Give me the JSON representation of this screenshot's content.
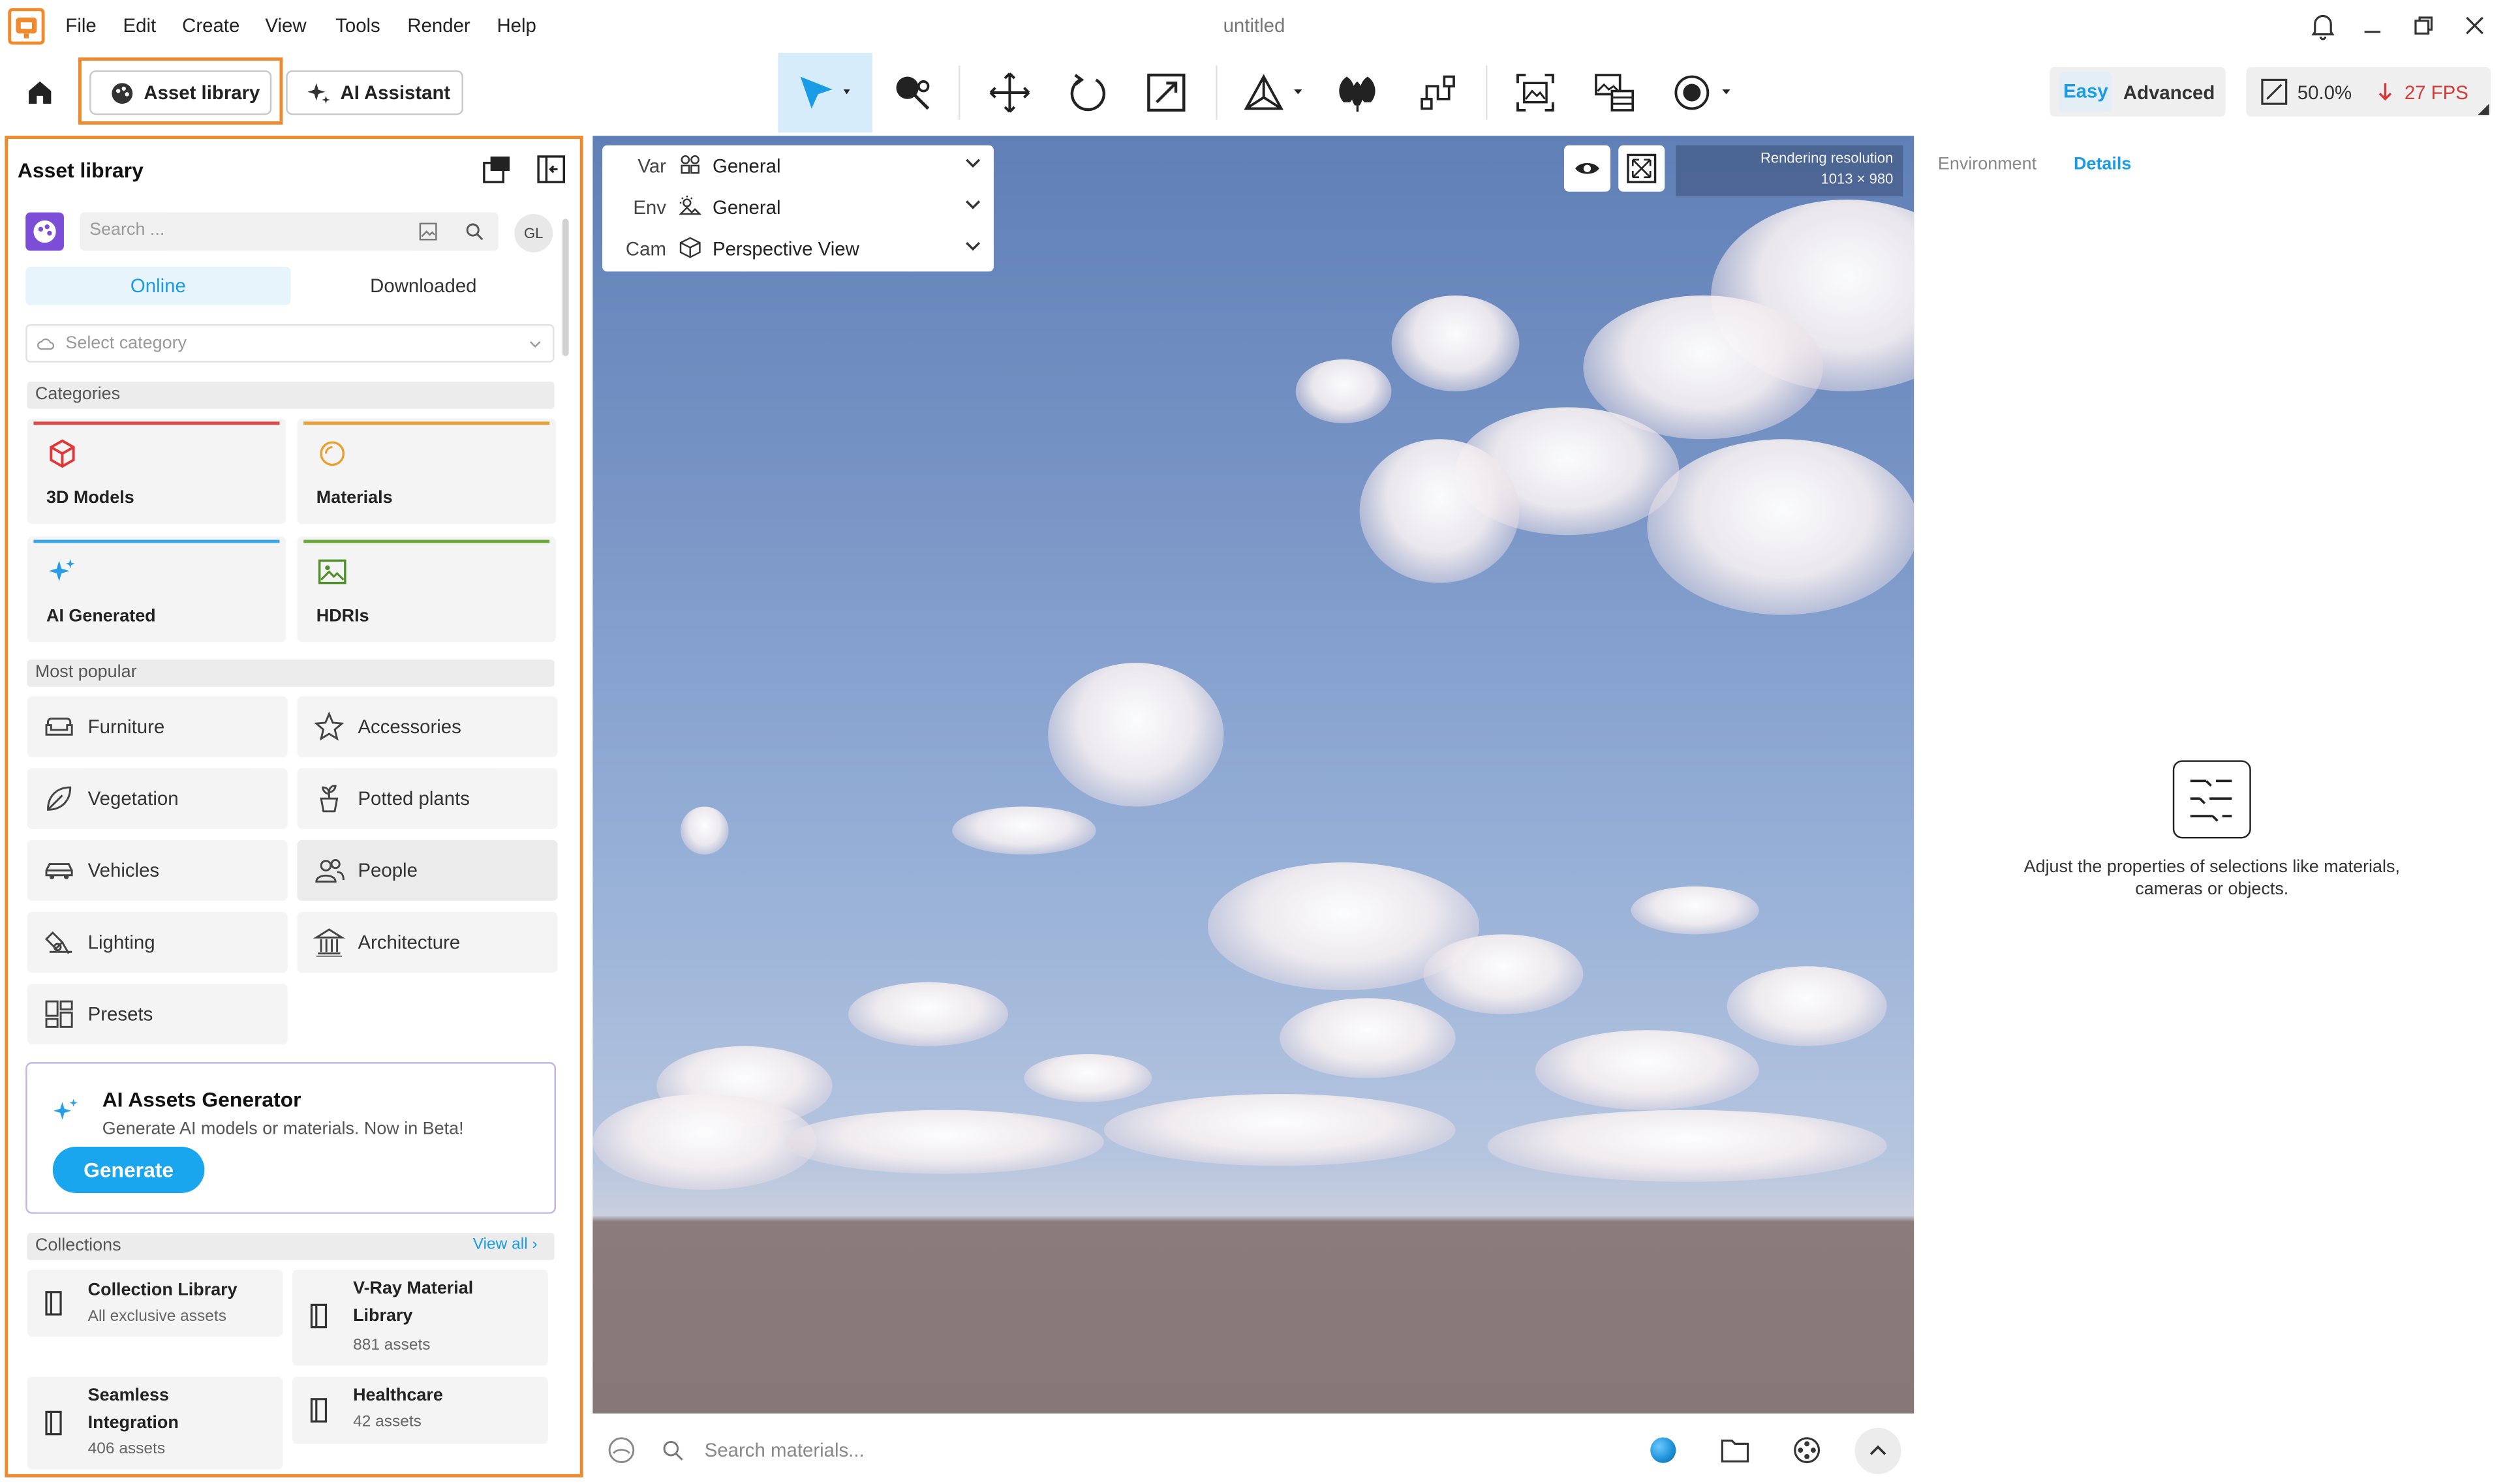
{
  "titlebar": {
    "document_title": "untitled",
    "menu": [
      "File",
      "Edit",
      "Create",
      "View",
      "Tools",
      "Render",
      "Help"
    ]
  },
  "toolbar": {
    "asset_library_label": "Asset library",
    "ai_assistant_label": "AI Assistant",
    "mode_easy": "Easy",
    "mode_advanced": "Advanced",
    "zoom": "50.0%",
    "fps": "27 FPS"
  },
  "left_panel": {
    "title": "Asset library",
    "search_placeholder": "Search ...",
    "user_initials": "GL",
    "tabs": [
      "Online",
      "Downloaded"
    ],
    "category_placeholder": "Select category",
    "categories_header": "Categories",
    "categories": [
      "3D Models",
      "Materials",
      "AI Generated",
      "HDRIs"
    ],
    "popular_header": "Most popular",
    "popular": [
      "Furniture",
      "Accessories",
      "Vegetation",
      "Potted plants",
      "Vehicles",
      "People",
      "Lighting",
      "Architecture",
      "Presets"
    ],
    "ai_card": {
      "title": "AI Assets Generator",
      "desc": "Generate AI models or materials. Now in Beta!",
      "button": "Generate"
    },
    "collections_header": "Collections",
    "view_all": "View all ›",
    "collections": [
      {
        "title": "Collection Library",
        "sub": "All exclusive assets"
      },
      {
        "title": "V-Ray Material Library",
        "sub": "881 assets"
      },
      {
        "title": "Seamless Integration",
        "sub": "406 assets"
      },
      {
        "title": "Healthcare",
        "sub": "42 assets"
      }
    ]
  },
  "viewport": {
    "var_key": "Var",
    "var_value": "General",
    "env_key": "Env",
    "env_value": "General",
    "cam_key": "Cam",
    "cam_value": "Perspective View",
    "render_res_label": "Rendering resolution",
    "render_res_value": "1013 × 980"
  },
  "bottom_bar": {
    "search_placeholder": "Search materials..."
  },
  "right_panel": {
    "tab_environment": "Environment",
    "tab_details": "Details",
    "empty_line1": "Adjust the properties of selections like materials,",
    "empty_line2": "cameras or objects."
  },
  "colors": {
    "accent_blue": "#1a9be6",
    "highlight_orange": "#f08a2e",
    "fps_red": "#d23b3b",
    "tab_active_bg": "#e8f4fc",
    "generate_button": "#1aa6ee"
  }
}
